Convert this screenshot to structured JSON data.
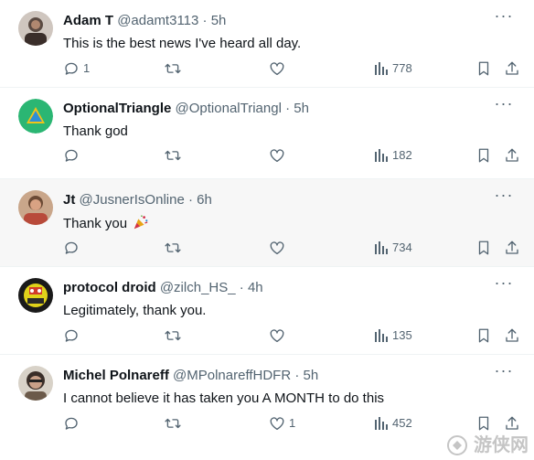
{
  "tweets": [
    {
      "name": "Adam T",
      "handle": "@adamt3113",
      "sep": "·",
      "time": "5h",
      "text": "This is the best news I've heard all day.",
      "replies": "1",
      "retweets": "",
      "likes": "",
      "views": "778",
      "avatar_color": "#5a4a42"
    },
    {
      "name": "OptionalTriangle",
      "handle": "@OptionalTriangl",
      "sep": "·",
      "time": "5h",
      "text": "Thank god",
      "replies": "",
      "retweets": "",
      "likes": "",
      "views": "182",
      "avatar_color": "#2bb673"
    },
    {
      "name": "Jt",
      "handle": "@JusnerIsOnline",
      "sep": "·",
      "time": "6h",
      "text": "Thank you",
      "text_emoji": "party-popper-icon",
      "replies": "",
      "retweets": "",
      "likes": "",
      "views": "734",
      "avatar_color": "#b0654a"
    },
    {
      "name": "protocol droid",
      "handle": "@zilch_HS_",
      "sep": "·",
      "time": "4h",
      "text": "Legitimately, thank you.",
      "replies": "",
      "retweets": "",
      "likes": "",
      "views": "135",
      "avatar_color": "#e0d21a"
    },
    {
      "name": "Michel Polnareff",
      "handle": "@MPolnareffHDFR",
      "sep": "·",
      "time": "5h",
      "text": "I cannot believe it has taken you A MONTH to do this",
      "replies": "",
      "retweets": "",
      "likes": "1",
      "views": "452",
      "avatar_color": "#6b5a4a"
    }
  ],
  "more_label": "···",
  "watermark": "游侠网",
  "colors": {
    "text": "#0f1419",
    "secondary": "#536471",
    "highlight_bg": "#f7f7f7"
  }
}
